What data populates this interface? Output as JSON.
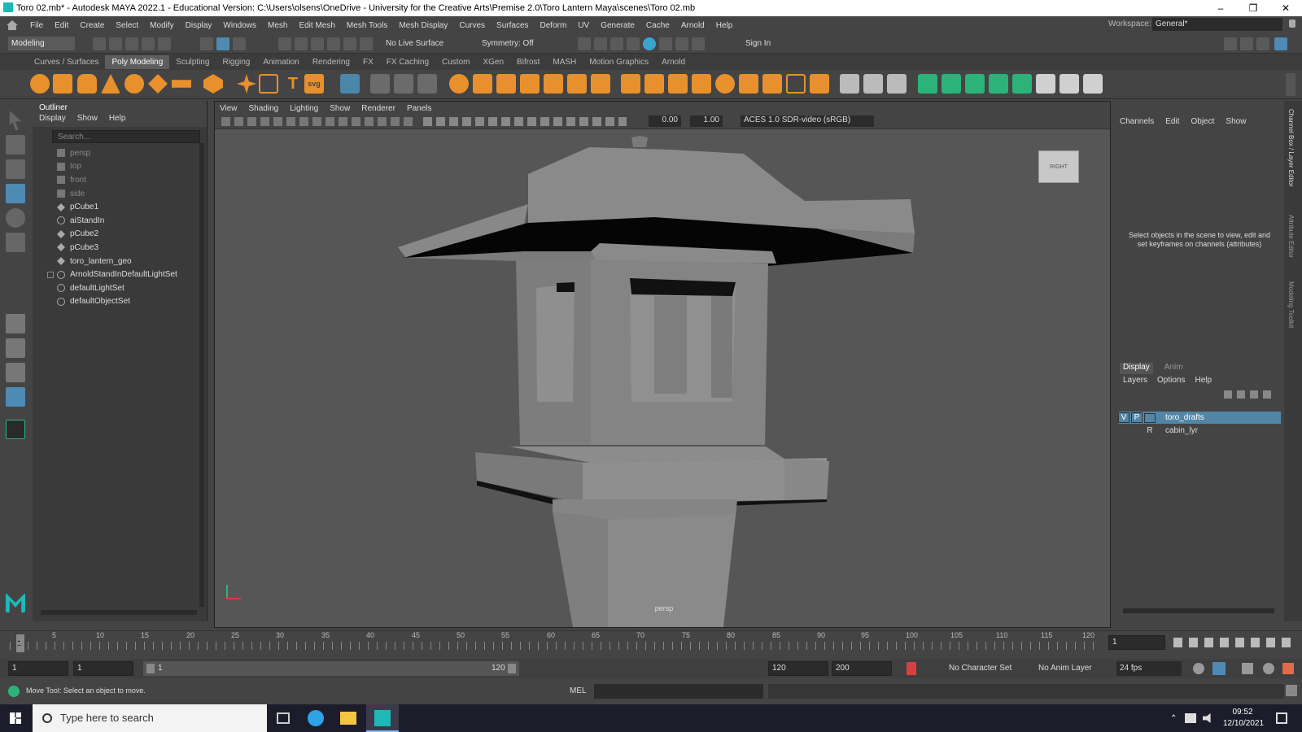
{
  "window": {
    "title": "Toro 02.mb* - Autodesk MAYA 2022.1 - Educational Version: C:\\Users\\olsens\\OneDrive - University for the Creative Arts\\Premise 2.0\\Toro Lantern Maya\\scenes\\Toro 02.mb",
    "minimize": "–",
    "maximize": "❐",
    "close": "✕"
  },
  "menubar": {
    "items": [
      "File",
      "Edit",
      "Create",
      "Select",
      "Modify",
      "Display",
      "Windows",
      "Mesh",
      "Edit Mesh",
      "Mesh Tools",
      "Mesh Display",
      "Curves",
      "Surfaces",
      "Deform",
      "UV",
      "Generate",
      "Cache",
      "Arnold",
      "Help"
    ],
    "workspace_label": "Workspace:",
    "workspace_value": "General*"
  },
  "statusline": {
    "mode": "Modeling",
    "live_surface": "No Live Surface",
    "symmetry": "Symmetry: Off",
    "sign_in": "Sign In"
  },
  "shelf": {
    "tabs": [
      "Curves / Surfaces",
      "Poly Modeling",
      "Sculpting",
      "Rigging",
      "Animation",
      "Rendering",
      "FX",
      "FX Caching",
      "Custom",
      "XGen",
      "Bifrost",
      "MASH",
      "Motion Graphics",
      "Arnold"
    ],
    "active_tab": "Poly Modeling",
    "text_tool": "T",
    "svg_tool": "svg"
  },
  "outliner": {
    "title": "Outliner",
    "menu": [
      "Display",
      "Show",
      "Help"
    ],
    "search_placeholder": "Search...",
    "items": [
      {
        "label": "persp",
        "type": "camera"
      },
      {
        "label": "top",
        "type": "camera"
      },
      {
        "label": "front",
        "type": "camera"
      },
      {
        "label": "side",
        "type": "camera"
      },
      {
        "label": "pCube1",
        "type": "mesh"
      },
      {
        "label": "aiStandIn",
        "type": "standin"
      },
      {
        "label": "pCube2",
        "type": "mesh"
      },
      {
        "label": "pCube3",
        "type": "mesh"
      },
      {
        "label": "toro_lantern_geo",
        "type": "mesh"
      },
      {
        "label": "ArnoldStandInDefaultLightSet",
        "type": "set"
      },
      {
        "label": "defaultLightSet",
        "type": "set"
      },
      {
        "label": "defaultObjectSet",
        "type": "set"
      }
    ]
  },
  "viewport": {
    "menu": [
      "View",
      "Shading",
      "Lighting",
      "Show",
      "Renderer",
      "Panels"
    ],
    "value_a": "0.00",
    "value_b": "1.00",
    "color_space": "ACES 1.0 SDR-video (sRGB)",
    "camera_label": "persp",
    "viewcube_label": "RIGHT"
  },
  "channelbox": {
    "menu": [
      "Channels",
      "Edit",
      "Object",
      "Show"
    ],
    "hint": "Select objects in the scene to view, edit and set keyframes on channels (attributes)",
    "layer_tabs": [
      "Display",
      "Anim"
    ],
    "layer_menu": [
      "Layers",
      "Options",
      "Help"
    ],
    "layers": [
      {
        "v": "V",
        "p": "P",
        "name": "toro_drafts",
        "selected": true
      },
      {
        "v": "",
        "p": "R",
        "name": "cabin_lyr",
        "selected": false
      }
    ],
    "side_tabs": [
      "Channel Box / Layer Editor",
      "Attribute Editor",
      "Modeling Toolkit"
    ]
  },
  "timeline": {
    "ticks": [
      "1",
      "5",
      "10",
      "15",
      "20",
      "25",
      "30",
      "35",
      "40",
      "45",
      "50",
      "55",
      "60",
      "65",
      "70",
      "75",
      "80",
      "85",
      "90",
      "95",
      "100",
      "105",
      "110",
      "115",
      "120"
    ],
    "current_frame": "1"
  },
  "rangebar": {
    "start_field": "1",
    "start_field2": "1",
    "range_start": "1",
    "range_end": "120",
    "end_field": "120",
    "end_field2": "200",
    "character_set": "No Character Set",
    "anim_layer": "No Anim Layer",
    "fps": "24 fps"
  },
  "commandline": {
    "help_text": "Move Tool: Select an object to move.",
    "mel_label": "MEL"
  },
  "taskbar": {
    "search_placeholder": "Type here to search",
    "time": "09:52",
    "date": "12/10/2021"
  },
  "colors": {
    "selected_layer": "#5285a6",
    "active_tool": "#4f8ab4",
    "maya_teal": "#1fb8b8"
  }
}
